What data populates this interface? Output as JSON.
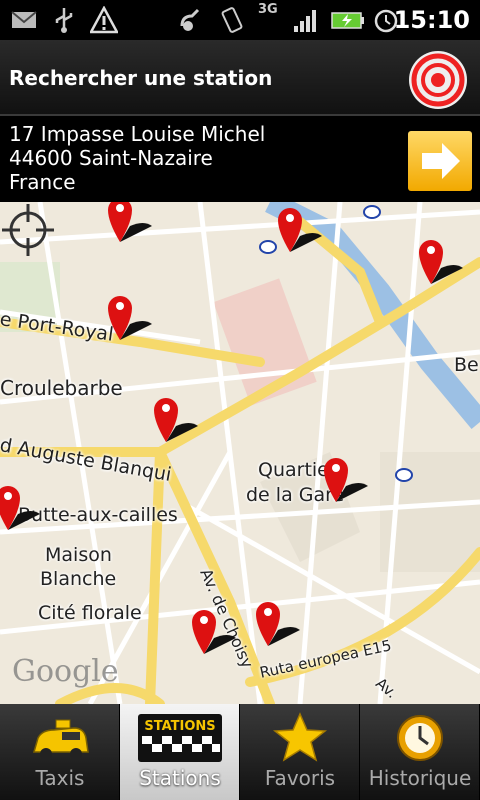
{
  "status_bar": {
    "time": "15:10",
    "network_type": "3G",
    "icons": [
      "gmail-icon",
      "usb-icon",
      "warning-icon",
      "satellite-icon",
      "vibrate-icon",
      "signal-icon",
      "battery-charging-icon",
      "alarm-icon"
    ]
  },
  "header": {
    "title": "Rechercher une station"
  },
  "address": {
    "line1": "17 Impasse Louise Michel",
    "line2": "44600 Saint-Nazaire",
    "line3": "France"
  },
  "map": {
    "labels": {
      "port_royal": "e Port-Royal",
      "croulebarbe": "Croulebarbe",
      "auguste_blanqui": "d Auguste Blanqui",
      "butte_aux_cailles": "Butte-aux-cailles",
      "maison": "Maison",
      "blanche": "Blanche",
      "cite_florale": "Cité florale",
      "quartier": "Quartier",
      "de_la_gare": "de la Gare",
      "av_de_choisy": "Av. de Choisy",
      "ruta_europea": "Ruta europea E15",
      "av": "Av.",
      "be": "Be",
      "google": "Google"
    },
    "road_colors": {
      "major": "#f6d96b",
      "minor": "#ffffff",
      "water": "#9cc0e4",
      "park": "#c9dfa8",
      "block": "#f0c9c0"
    }
  },
  "tabs": [
    {
      "label": "Taxis",
      "icon": "taxi-icon",
      "active": false
    },
    {
      "label": "Stations",
      "icon": "stations-sign-icon",
      "active": true,
      "sign_text": "STATIONS"
    },
    {
      "label": "Favoris",
      "icon": "star-icon",
      "active": false
    },
    {
      "label": "Historique",
      "icon": "history-clock-icon",
      "active": false
    }
  ]
}
